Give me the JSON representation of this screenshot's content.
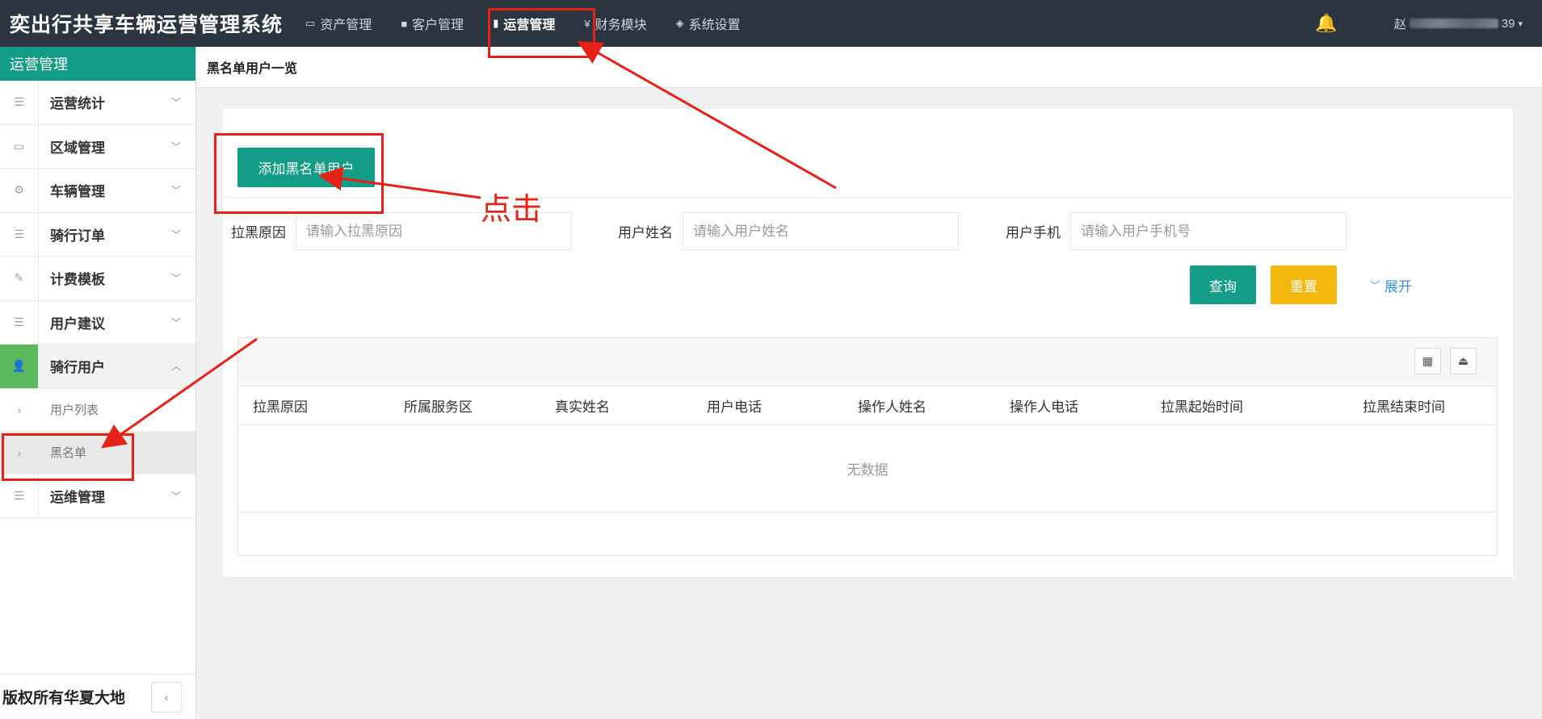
{
  "app": {
    "title": "奕出行共享车辆运营管理系统"
  },
  "topnav": {
    "items": [
      {
        "icon": "monitor-icon",
        "label": "资产管理"
      },
      {
        "icon": "briefcase-icon",
        "label": "客户管理"
      },
      {
        "icon": "book-icon",
        "label": "运营管理",
        "active": true
      },
      {
        "icon": "yen-icon",
        "label": "财务模块"
      },
      {
        "icon": "cube-icon",
        "label": "系统设置"
      }
    ],
    "user_prefix": "赵",
    "user_suffix": "39"
  },
  "sidebar": {
    "title": "运营管理",
    "items": [
      {
        "label": "运营统计",
        "icon": "list-icon"
      },
      {
        "label": "区域管理",
        "icon": "card-icon"
      },
      {
        "label": "车辆管理",
        "icon": "gear-icon"
      },
      {
        "label": "骑行订单",
        "icon": "list-icon"
      },
      {
        "label": "计费模板",
        "icon": "edit-icon"
      },
      {
        "label": "用户建议",
        "icon": "list-icon"
      },
      {
        "label": "骑行用户",
        "icon": "user-icon",
        "open": true
      },
      {
        "label": "运维管理",
        "icon": "list-icon"
      }
    ],
    "sub_items": [
      {
        "label": "用户列表"
      },
      {
        "label": "黑名单",
        "active": true
      }
    ],
    "footer": "版权所有华夏大地"
  },
  "page": {
    "title": "黑名单用户一览",
    "add_button": "添加黑名单用户",
    "search": {
      "reason_label": "拉黑原因",
      "reason_placeholder": "请输入拉黑原因",
      "name_label": "用户姓名",
      "name_placeholder": "请输入用户姓名",
      "phone_label": "用户手机",
      "phone_placeholder": "请输入用户手机号"
    },
    "query_button": "查询",
    "reset_button": "重置",
    "expand_label": "展开",
    "table": {
      "columns": [
        "拉黑原因",
        "所属服务区",
        "真实姓名",
        "用户电话",
        "操作人姓名",
        "操作人电话",
        "拉黑起始时间",
        "拉黑结束时间"
      ],
      "empty_text": "无数据"
    }
  },
  "annotation": {
    "click_label": "点击",
    "color": "#e62117"
  }
}
